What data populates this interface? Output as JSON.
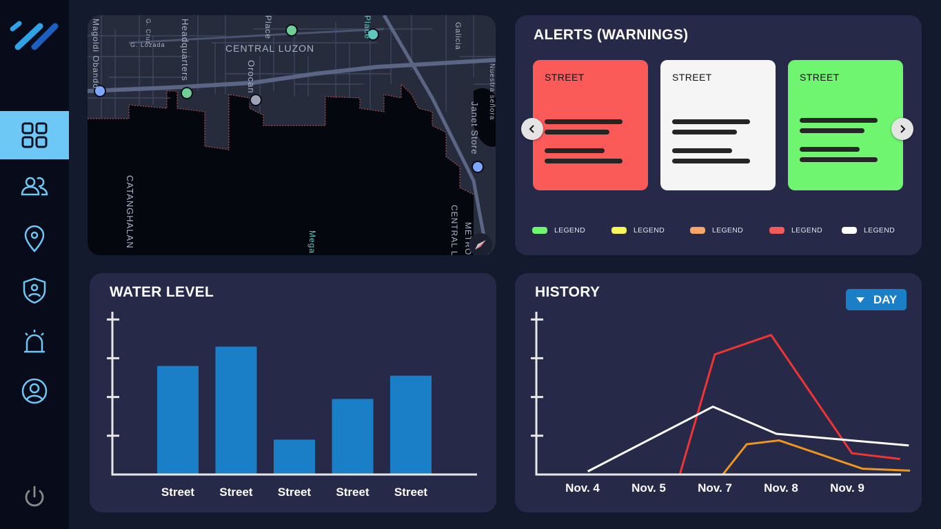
{
  "colors": {
    "accent": "#6ec8f5",
    "bar": "#1a7fc7",
    "panel": "#262a48",
    "background": "#141a2e",
    "sidebar": "#080b1a"
  },
  "sidebar": {
    "items": [
      {
        "icon": "dashboard-grid-icon",
        "active": true
      },
      {
        "icon": "users-icon",
        "active": false
      },
      {
        "icon": "location-pin-icon",
        "active": false
      },
      {
        "icon": "shield-user-icon",
        "active": false
      },
      {
        "icon": "alarm-siren-icon",
        "active": false
      },
      {
        "icon": "user-circle-icon",
        "active": false
      }
    ],
    "bottom_icon": "power-icon"
  },
  "map": {
    "labels": [
      "CENTRAL LUZON",
      "Headquarters",
      "Orocan",
      "Janet Store",
      "CATANGHALAN",
      "CENTRAL LUZON",
      "METRO M",
      "Mega",
      "Galicia",
      "Nuestra señora",
      "G. Lozada",
      "G. Cruz",
      "Magoldi Obando",
      "Place",
      "Place"
    ]
  },
  "alerts": {
    "title": "ALERTS (WARNINGS)",
    "cards": [
      {
        "label": "STREET",
        "color": "#fa5a58"
      },
      {
        "label": "STREET",
        "color": "#f5f5f5"
      },
      {
        "label": "STREET",
        "color": "#6ff56f"
      }
    ],
    "legend": [
      {
        "label": "LEGEND",
        "color": "#6ff56f"
      },
      {
        "label": "LEGEND",
        "color": "#f8f85a"
      },
      {
        "label": "LEGEND",
        "color": "#fba468"
      },
      {
        "label": "LEGEND",
        "color": "#f55a5a"
      },
      {
        "label": "LEGEND",
        "color": "#ffffff"
      }
    ]
  },
  "water_level": {
    "title": "WATER LEVEL"
  },
  "history": {
    "title": "HISTORY",
    "filter_label": "DAY"
  },
  "chart_data": [
    {
      "type": "bar",
      "title": "WATER LEVEL",
      "categories": [
        "Street",
        "Street",
        "Street",
        "Street",
        "Street"
      ],
      "values": [
        2.8,
        3.3,
        0.9,
        1.95,
        2.55
      ],
      "ylim": [
        0,
        4.2
      ],
      "yticks": [
        1,
        2,
        3,
        4
      ],
      "color": "#1a7fc7",
      "grid": false,
      "ylabel": "",
      "xlabel": ""
    },
    {
      "type": "line",
      "title": "HISTORY",
      "x_tick_labels": [
        "Nov. 4",
        "Nov. 5",
        "Nov. 7",
        "Nov. 8",
        "Nov. 9"
      ],
      "xlim": [
        0,
        5
      ],
      "ylim": [
        0,
        4.2
      ],
      "yticks": [
        1,
        2,
        3,
        4
      ],
      "grid": false,
      "series": [
        {
          "color": "#f03434",
          "x": [
            1.97,
            2.5,
            3.35,
            4.57,
            5.3
          ],
          "y": [
            0,
            3.1,
            3.6,
            0.55,
            0.4
          ]
        },
        {
          "color": "#ffffff",
          "x": [
            0.58,
            2.47,
            3.43,
            5.43
          ],
          "y": [
            0.08,
            1.75,
            1.05,
            0.75
          ]
        },
        {
          "color": "#f0961e",
          "x": [
            2.62,
            2.98,
            3.47,
            4.73,
            5.45
          ],
          "y": [
            0,
            0.78,
            0.88,
            0.15,
            0.1
          ]
        }
      ]
    }
  ]
}
